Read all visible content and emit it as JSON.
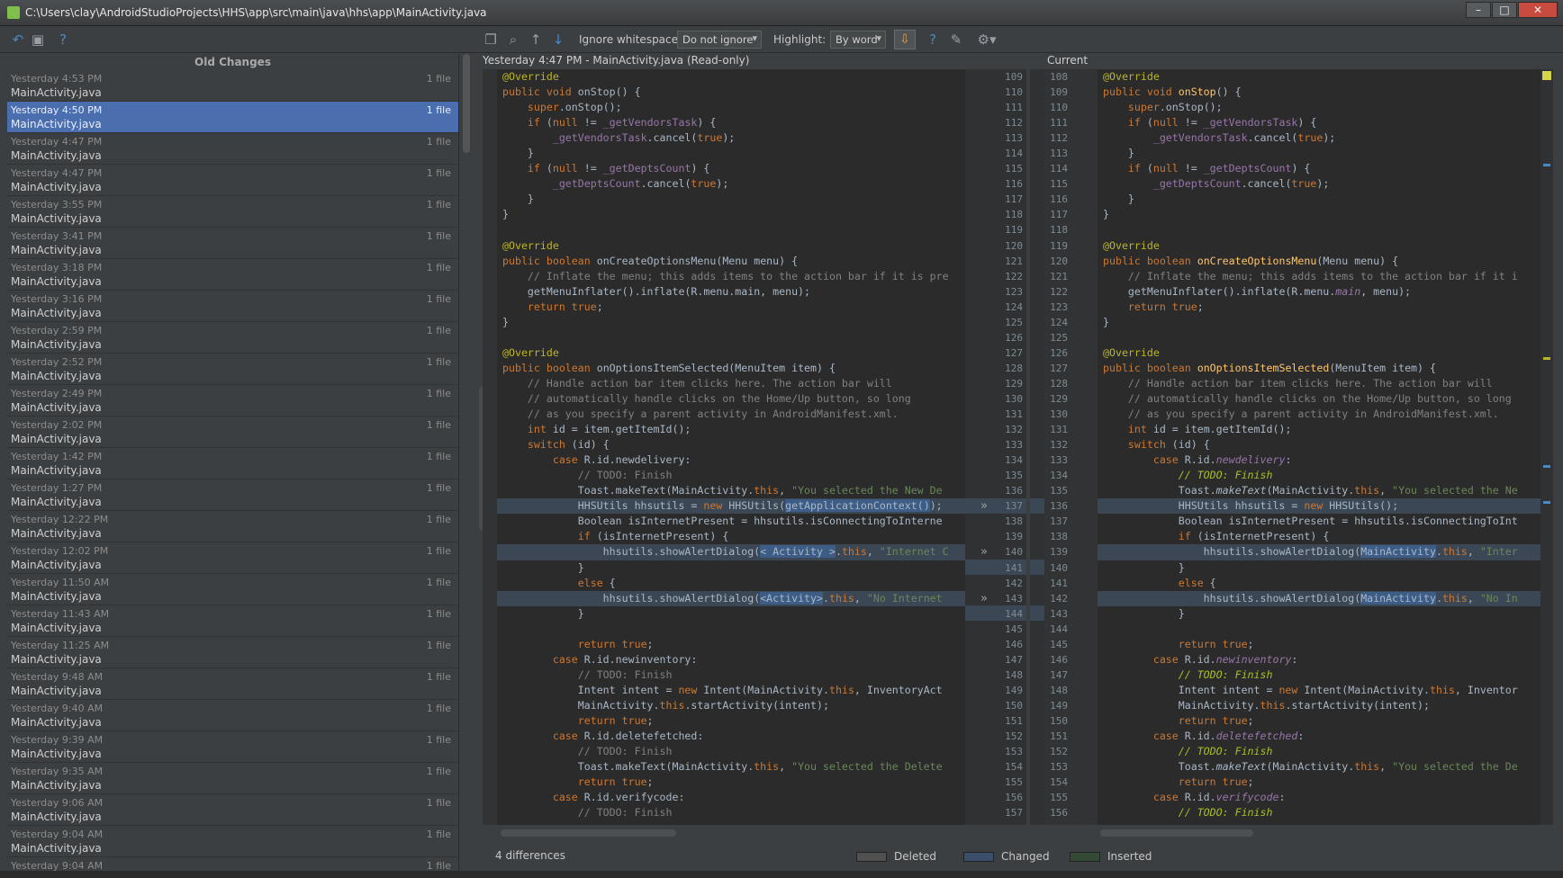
{
  "window": {
    "title": "C:\\Users\\clay\\AndroidStudioProjects\\HHS\\app\\src\\main\\java\\hhs\\app\\MainActivity.java"
  },
  "toolbar": {
    "ignore_label": "Ignore whitespace:",
    "ignore_value": "Do not ignore",
    "highlight_label": "Highlight:",
    "highlight_value": "By word"
  },
  "left_panel": {
    "header": "Old Changes",
    "items": [
      {
        "time": "Yesterday 4:53 PM",
        "count": "1 file",
        "file": "MainActivity.java"
      },
      {
        "time": "Yesterday 4:50 PM",
        "count": "1 file",
        "file": "MainActivity.java"
      },
      {
        "time": "Yesterday 4:47 PM",
        "count": "1 file",
        "file": "MainActivity.java"
      },
      {
        "time": "Yesterday 4:47 PM",
        "count": "1 file",
        "file": "MainActivity.java"
      },
      {
        "time": "Yesterday 3:55 PM",
        "count": "1 file",
        "file": "MainActivity.java"
      },
      {
        "time": "Yesterday 3:41 PM",
        "count": "1 file",
        "file": "MainActivity.java"
      },
      {
        "time": "Yesterday 3:18 PM",
        "count": "1 file",
        "file": "MainActivity.java"
      },
      {
        "time": "Yesterday 3:16 PM",
        "count": "1 file",
        "file": "MainActivity.java"
      },
      {
        "time": "Yesterday 2:59 PM",
        "count": "1 file",
        "file": "MainActivity.java"
      },
      {
        "time": "Yesterday 2:52 PM",
        "count": "1 file",
        "file": "MainActivity.java"
      },
      {
        "time": "Yesterday 2:49 PM",
        "count": "1 file",
        "file": "MainActivity.java"
      },
      {
        "time": "Yesterday 2:02 PM",
        "count": "1 file",
        "file": "MainActivity.java"
      },
      {
        "time": "Yesterday 1:42 PM",
        "count": "1 file",
        "file": "MainActivity.java"
      },
      {
        "time": "Yesterday 1:27 PM",
        "count": "1 file",
        "file": "MainActivity.java"
      },
      {
        "time": "Yesterday 12:22 PM",
        "count": "1 file",
        "file": "MainActivity.java"
      },
      {
        "time": "Yesterday 12:02 PM",
        "count": "1 file",
        "file": "MainActivity.java"
      },
      {
        "time": "Yesterday 11:50 AM",
        "count": "1 file",
        "file": "MainActivity.java"
      },
      {
        "time": "Yesterday 11:43 AM",
        "count": "1 file",
        "file": "MainActivity.java"
      },
      {
        "time": "Yesterday 11:25 AM",
        "count": "1 file",
        "file": "MainActivity.java"
      },
      {
        "time": "Yesterday 9:48 AM",
        "count": "1 file",
        "file": "MainActivity.java"
      },
      {
        "time": "Yesterday 9:40 AM",
        "count": "1 file",
        "file": "MainActivity.java"
      },
      {
        "time": "Yesterday 9:39 AM",
        "count": "1 file",
        "file": "MainActivity.java"
      },
      {
        "time": "Yesterday 9:35 AM",
        "count": "1 file",
        "file": "MainActivity.java"
      },
      {
        "time": "Yesterday 9:06 AM",
        "count": "1 file",
        "file": "MainActivity.java"
      },
      {
        "time": "Yesterday 9:04 AM",
        "count": "1 file",
        "file": "MainActivity.java"
      },
      {
        "time": "Yesterday 9:04 AM",
        "count": "1 file",
        "file": ""
      }
    ]
  },
  "diff": {
    "left_title": "Yesterday 4:47 PM - MainActivity.java (Read-only)",
    "right_title": "Current",
    "differences": "4 differences",
    "legend": {
      "deleted": "Deleted",
      "changed": "Changed",
      "inserted": "Inserted"
    },
    "legend_colors": {
      "deleted": "#505050",
      "changed": "#3b4f6b",
      "inserted": "#344a35"
    },
    "left_line_numbers": [
      "109",
      "110",
      "111",
      "112",
      "113",
      "114",
      "115",
      "116",
      "117",
      "118",
      "119",
      "120",
      "121",
      "122",
      "123",
      "124",
      "125",
      "126",
      "127",
      "128",
      "129",
      "130",
      "131",
      "132",
      "133",
      "134",
      "135",
      "136",
      "137",
      "138",
      "139",
      "140",
      "141",
      "142",
      "143",
      "144",
      "145",
      "146",
      "147",
      "148",
      "149",
      "150",
      "151",
      "152",
      "153",
      "154",
      "155",
      "156",
      "157"
    ],
    "right_line_numbers": [
      "108",
      "109",
      "110",
      "111",
      "112",
      "113",
      "114",
      "115",
      "116",
      "117",
      "118",
      "119",
      "120",
      "121",
      "122",
      "123",
      "124",
      "125",
      "126",
      "127",
      "128",
      "129",
      "130",
      "131",
      "132",
      "133",
      "134",
      "135",
      "136",
      "137",
      "138",
      "139",
      "140",
      "141",
      "142",
      "143",
      "144",
      "145",
      "146",
      "147",
      "148",
      "149",
      "150",
      "151",
      "152",
      "153",
      "154",
      "155",
      "156"
    ]
  }
}
